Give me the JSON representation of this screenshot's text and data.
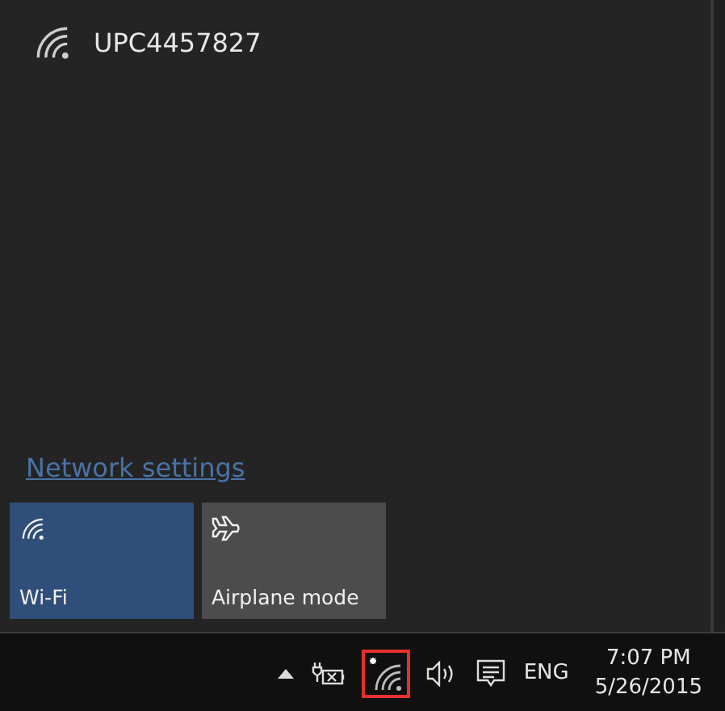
{
  "networks": [
    {
      "name": "UPC4457827"
    }
  ],
  "settings_link": "Network settings",
  "quick_actions": [
    {
      "kind": "wifi",
      "label": "Wi-Fi",
      "on": true
    },
    {
      "kind": "airplane",
      "label": "Airplane mode",
      "on": false
    }
  ],
  "taskbar": {
    "language": "ENG",
    "time": "7:07 PM",
    "date": "5/26/2015",
    "wifi_icon_highlighted": true
  }
}
